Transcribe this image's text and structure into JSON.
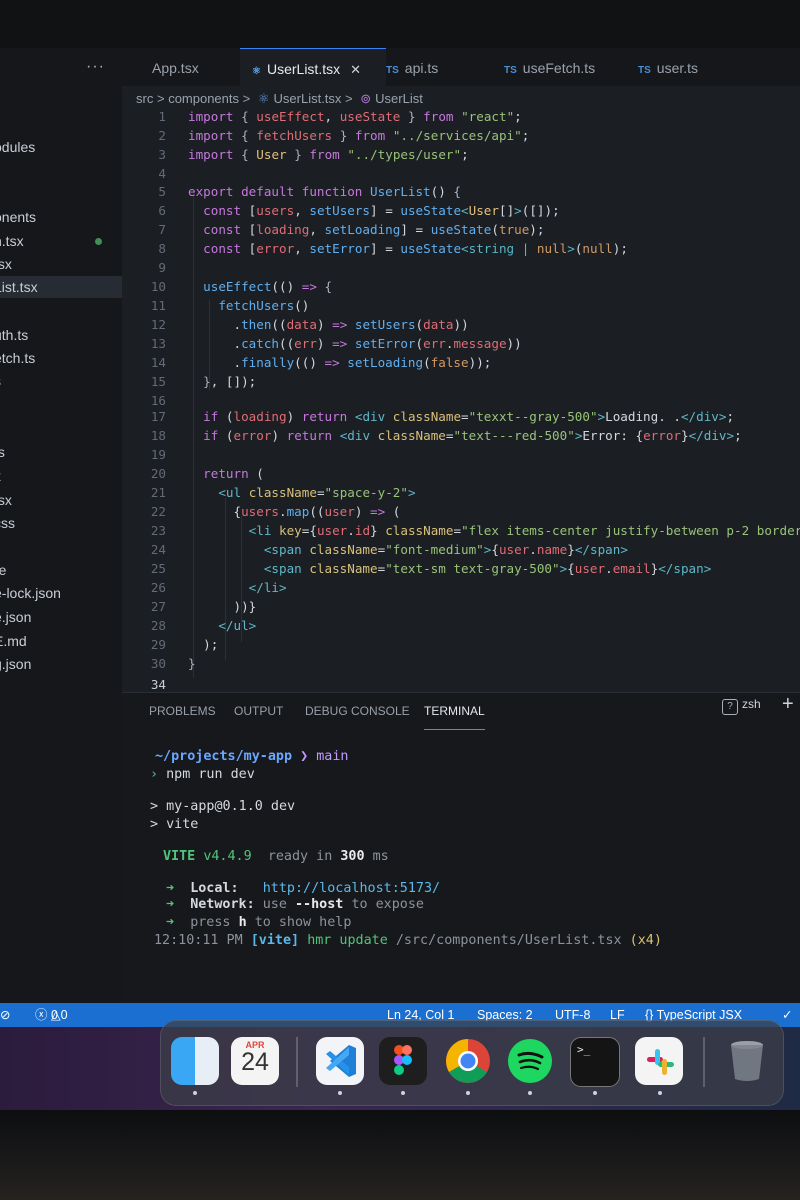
{
  "sidebar": {
    "more_label": "···",
    "items": [
      {
        "label": "odules",
        "active": false
      },
      {
        "label": "onents",
        "active": false
      },
      {
        "label": "n.tsx",
        "active": false
      },
      {
        "label": "tsx",
        "active": false
      },
      {
        "label": "List.tsx",
        "active": true
      },
      {
        "label": "uth.ts",
        "active": false
      },
      {
        "label": "etch.ts",
        "active": false
      },
      {
        "label": "s",
        "active": false
      },
      {
        "label": "ts",
        "active": false
      },
      {
        "label": "x",
        "active": false
      },
      {
        "label": "tsx",
        "active": false
      },
      {
        "label": "css",
        "active": false
      },
      {
        "label": "re",
        "active": false
      },
      {
        "label": "e-lock.json",
        "active": false
      },
      {
        "label": "e.json",
        "active": false
      },
      {
        "label": "E.md",
        "active": false
      },
      {
        "label": "g.json",
        "active": false
      }
    ]
  },
  "tabs": [
    {
      "label": "App.tsx",
      "type_badge": "",
      "active": false
    },
    {
      "label": "UserList.tsx",
      "type_badge": "",
      "active": true,
      "close": "✕"
    },
    {
      "label": "api.ts",
      "type_badge": "TS",
      "active": false
    },
    {
      "label": "useFetch.ts",
      "type_badge": "TS",
      "active": false
    },
    {
      "label": "user.ts",
      "type_badge": "TS",
      "active": false
    }
  ],
  "breadcrumb": {
    "parts": [
      "src",
      "components",
      "UserList.tsx",
      "UserList"
    ],
    "separator": ">"
  },
  "code_lines": [
    {
      "n": "1",
      "text": "import { useEffect, useState } from \"react\";"
    },
    {
      "n": "2",
      "text": "import { fetchUsers } from \"../services/api\";"
    },
    {
      "n": "3",
      "text": "import { User } from \"../types/user\";"
    },
    {
      "n": "4",
      "text": ""
    },
    {
      "n": "5",
      "text": "export default function UserList() {"
    },
    {
      "n": "6",
      "text": "  const [users, setUsers] = useState<User[]>([]);"
    },
    {
      "n": "7",
      "text": "  const [loading, setLoading] = useState(true);"
    },
    {
      "n": "8",
      "text": "  const [error, setError] = useState<string | null>(null);"
    },
    {
      "n": "9",
      "text": ""
    },
    {
      "n": "10",
      "text": "  useEffect(() => {"
    },
    {
      "n": "11",
      "text": "    fetchUsers()"
    },
    {
      "n": "12",
      "text": "      .then((data) => setUsers(data))"
    },
    {
      "n": "13",
      "text": "      .catch((err) => setError(err.message))"
    },
    {
      "n": "14",
      "text": "      .finally(() => setLoading(false));"
    },
    {
      "n": "15",
      "text": "  }, []);"
    },
    {
      "n": "16",
      "text": ""
    },
    {
      "n": "17",
      "text": "  if (loading) return <div className=\"texxt--gray-500\">Loading. .</div>;"
    },
    {
      "n": "18",
      "text": "  if (error) return <div className=\"text---red-500\">Error: {error}</div>;"
    },
    {
      "n": "19",
      "text": ""
    },
    {
      "n": "20",
      "text": "  return ("
    },
    {
      "n": "21",
      "text": "    <ul className=\"space-y-2\">"
    },
    {
      "n": "22",
      "text": "      {users.map((user) => ("
    },
    {
      "n": "23",
      "text": "        <li key={user.id} className=\"flex items-center justify-between p-2 border"
    },
    {
      "n": "24",
      "text": "          <span className=\"font-medium\">{user.name}</span>"
    },
    {
      "n": "25",
      "text": "          <span className=\"text-sm text-gray-500\">{user.email}</span>"
    },
    {
      "n": "26",
      "text": "        </li>"
    },
    {
      "n": "27",
      "text": "      ))}"
    },
    {
      "n": "28",
      "text": "    </ul>"
    },
    {
      "n": "29",
      "text": "  );"
    },
    {
      "n": "30",
      "text": "}"
    },
    {
      "n": "34",
      "text": ""
    }
  ],
  "panel": {
    "tabs": [
      "PROBLEMS",
      "OUTPUT",
      "DEBUG CONSOLE",
      "TERMINAL"
    ],
    "active_tab": "TERMINAL",
    "shell": "zsh",
    "add_label": "+"
  },
  "terminal": {
    "prompt_path": "~/projects/my-app",
    "branch_arrow": "❯",
    "branch": "main",
    "cmd_arrow": "›",
    "command": "npm run dev",
    "out1": "> my-app@0.1.0 dev",
    "out2": "> vite",
    "vite_name": "VITE",
    "vite_version": "v4.4.9",
    "ready_text": "ready in",
    "ready_ms": "300",
    "ready_unit": "ms",
    "arrow": "➜",
    "local_label": "Local:",
    "local_url": "http://localhost:5173/",
    "network_label": "Network:",
    "network_pre": "use",
    "network_flag": "--host",
    "network_post": "to expose",
    "help_pre": "press",
    "help_key": "h",
    "help_post": "to show help",
    "hmr_time": "12:10:11 PM",
    "hmr_tag": "[vite]",
    "hmr_text": "hmr update",
    "hmr_path": "/src/components/UserList.tsx",
    "hmr_count": "(x4)"
  },
  "status": {
    "left_icon": "⊘",
    "errors": "0",
    "warnings": "0",
    "cursor": "Ln 24, Col 1",
    "spaces": "Spaces: 2",
    "encoding": "UTF-8",
    "eol": "LF",
    "language": "{} TypeScript JSX",
    "check": "✓"
  },
  "dock": {
    "calendar_month": "APR",
    "calendar_day": "24",
    "apps": [
      "finder-icon",
      "calendar-icon",
      "vscode-icon",
      "figma-icon",
      "chrome-icon",
      "spotify-icon",
      "terminal-icon",
      "slack-icon",
      "trash-icon"
    ]
  },
  "colors": {
    "status_bar": "#1a6fd0",
    "editor_bg": "#1b1e23",
    "accent": "#3b82f6"
  }
}
